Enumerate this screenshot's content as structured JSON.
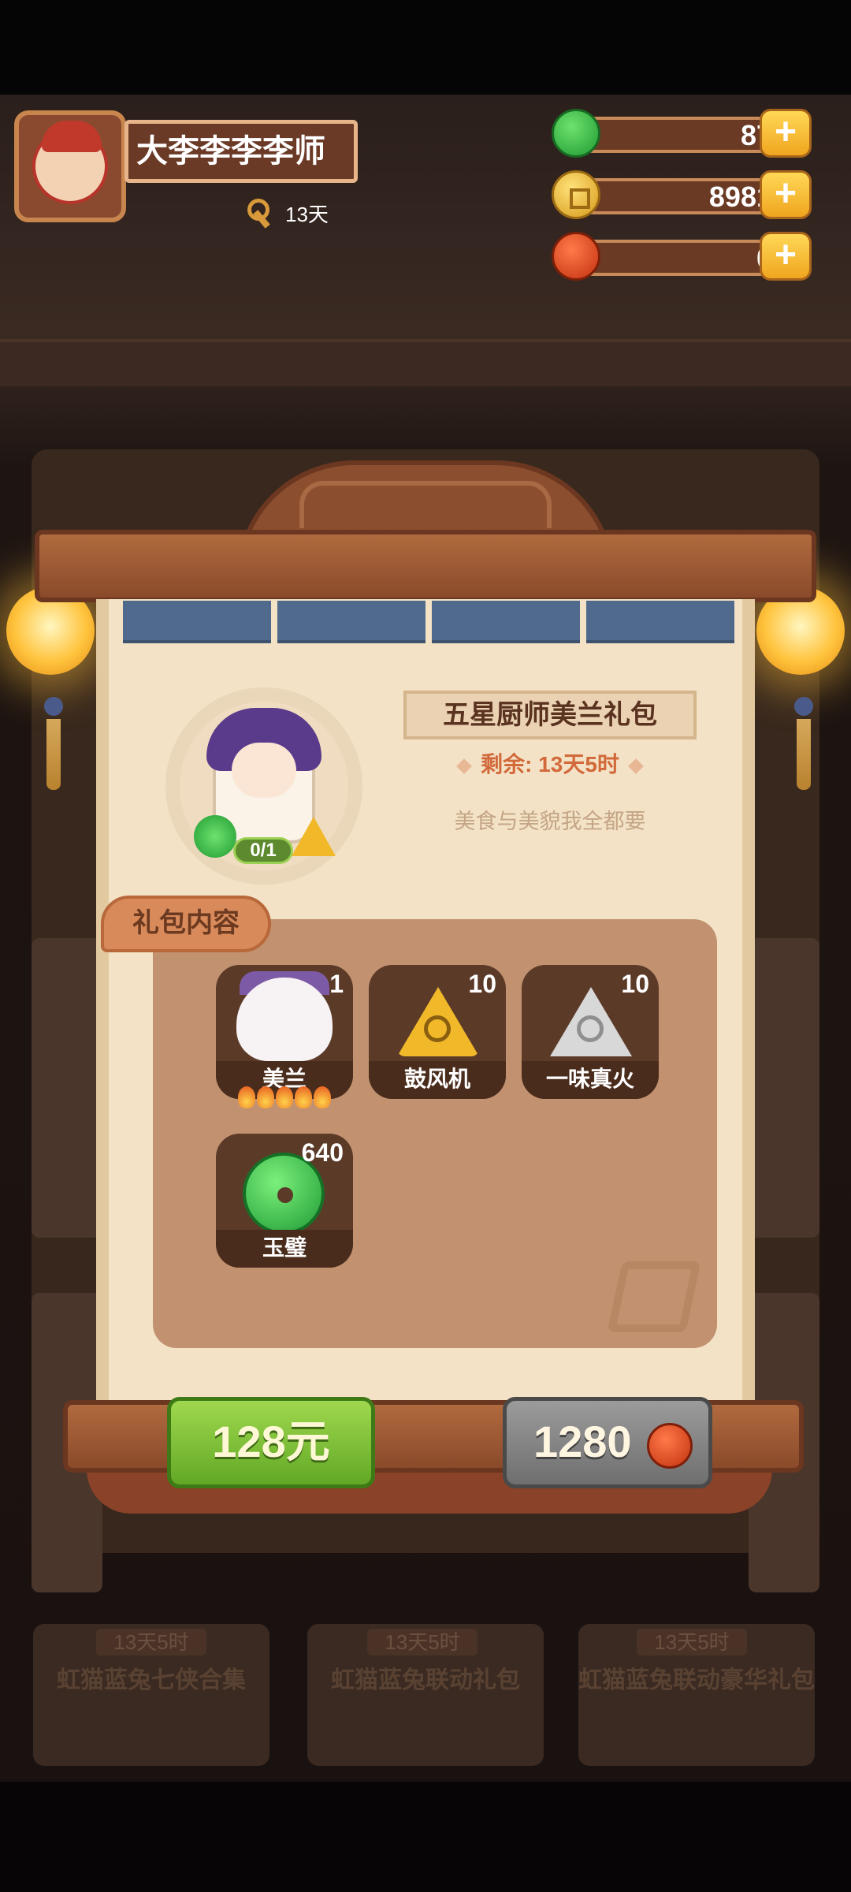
{
  "player": {
    "name": "大李李李李师",
    "days": "13天"
  },
  "currencies": [
    {
      "name": "jade",
      "value": "87",
      "icon": "jade-icon"
    },
    {
      "name": "coin",
      "value": "8981",
      "icon": "coin-icon"
    },
    {
      "name": "red-jade",
      "value": "0",
      "icon": "red-jade-icon"
    }
  ],
  "add_label": "+",
  "background": {
    "cards": [
      {
        "tag": "13天5时",
        "title": "虹猫蓝兔七侠合集"
      },
      {
        "tag": "13天5时",
        "title": "虹猫蓝兔联动礼包"
      },
      {
        "tag": "13天5时",
        "title": "虹猫蓝兔联动豪华礼包"
      }
    ]
  },
  "pack": {
    "title": "五星厨师美兰礼包",
    "remaining": "剩余: 13天5时",
    "description": "美食与美貌我全都要",
    "owned_count": "0/1",
    "contents_label": "礼包内容",
    "items": [
      {
        "name": "美兰",
        "count": "1",
        "icon": "character-meilan-icon",
        "stars": 5
      },
      {
        "name": "鼓风机",
        "count": "10",
        "icon": "gold-fan-icon"
      },
      {
        "name": "一味真火",
        "count": "10",
        "icon": "silver-fan-icon"
      },
      {
        "name": "玉璧",
        "count": "640",
        "icon": "jade-disc-icon"
      }
    ]
  },
  "buttons": {
    "price": "128元",
    "alt_price": "1280"
  },
  "colors": {
    "buy_button": "#7cc03a",
    "alt_button": "#8a8a8a",
    "accent_orange": "#d2693a"
  }
}
